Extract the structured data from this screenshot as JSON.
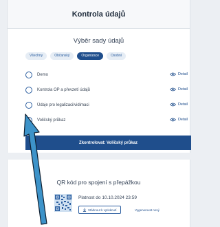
{
  "header": {
    "title": "Kontrola údajů"
  },
  "dataset": {
    "title": "Výběr sady údajů",
    "chips": [
      {
        "label": "Všechny",
        "active": false
      },
      {
        "label": "Občanský",
        "active": false
      },
      {
        "label": "Organizace",
        "active": true
      },
      {
        "label": "Osobní",
        "active": false
      }
    ],
    "options": [
      {
        "label": "Demo",
        "checked": false,
        "detail": "Detail"
      },
      {
        "label": "Kontrola OP a převzetí údajů",
        "checked": false,
        "detail": "Detail"
      },
      {
        "label": "Údaje pro legalizaci/vidimaci",
        "checked": false,
        "detail": "Detail"
      },
      {
        "label": "Voličský průkaz",
        "checked": true,
        "detail": "Detail"
      }
    ],
    "submit_label": "Zkontrolovat: Voličský průkaz"
  },
  "qr": {
    "title": "QR kód pro spojení s přepážkou",
    "validity": "Platnost do 10.10.2024 23:59",
    "download_label": "Stáhnout k vytisknutí",
    "regenerate_label": "Vygenerovat nový"
  },
  "colors": {
    "accent": "#1f4e8c",
    "arrow": "#3d93c9",
    "background": "#eceff3"
  },
  "icons": {
    "detail": "eye-icon",
    "download": "download-icon",
    "pointer": "pointer-arrow"
  }
}
